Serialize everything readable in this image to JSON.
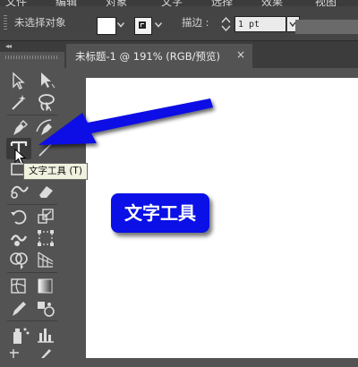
{
  "menubar": {
    "items": [
      "文件",
      "编辑",
      "对象",
      "文字",
      "选择",
      "效果",
      "视图"
    ]
  },
  "control_bar": {
    "selection_status": "未选择对象",
    "stroke_label": "描边 :",
    "stroke_weight_value": "1 pt",
    "fill_color": "#ffffff"
  },
  "document_tab": {
    "title": "未标题-1 @ 191% (RGB/预览)",
    "close_symbol": "×"
  },
  "toolbar": {
    "collapse_symbol": "◂◂",
    "tools": [
      "selection-tool",
      "direct-selection-tool",
      "magic-wand-tool",
      "lasso-tool",
      "pen-tool",
      "curvature-tool",
      "type-tool",
      "line-segment-tool",
      "rectangle-tool",
      "paintbrush-tool",
      "shaper-tool",
      "eraser-tool",
      "rotate-tool",
      "scale-tool",
      "warp-tool",
      "free-transform-tool",
      "shape-builder-tool",
      "perspective-grid-tool",
      "mesh-tool",
      "gradient-tool",
      "eyedropper-tool",
      "blend-tool",
      "symbol-sprayer-tool",
      "column-graph-tool"
    ],
    "selected_tool": "type-tool"
  },
  "tooltip": {
    "text": "文字工具 (T)"
  },
  "annotation": {
    "label": "文字工具",
    "arrow_color": "#0a10e6"
  }
}
